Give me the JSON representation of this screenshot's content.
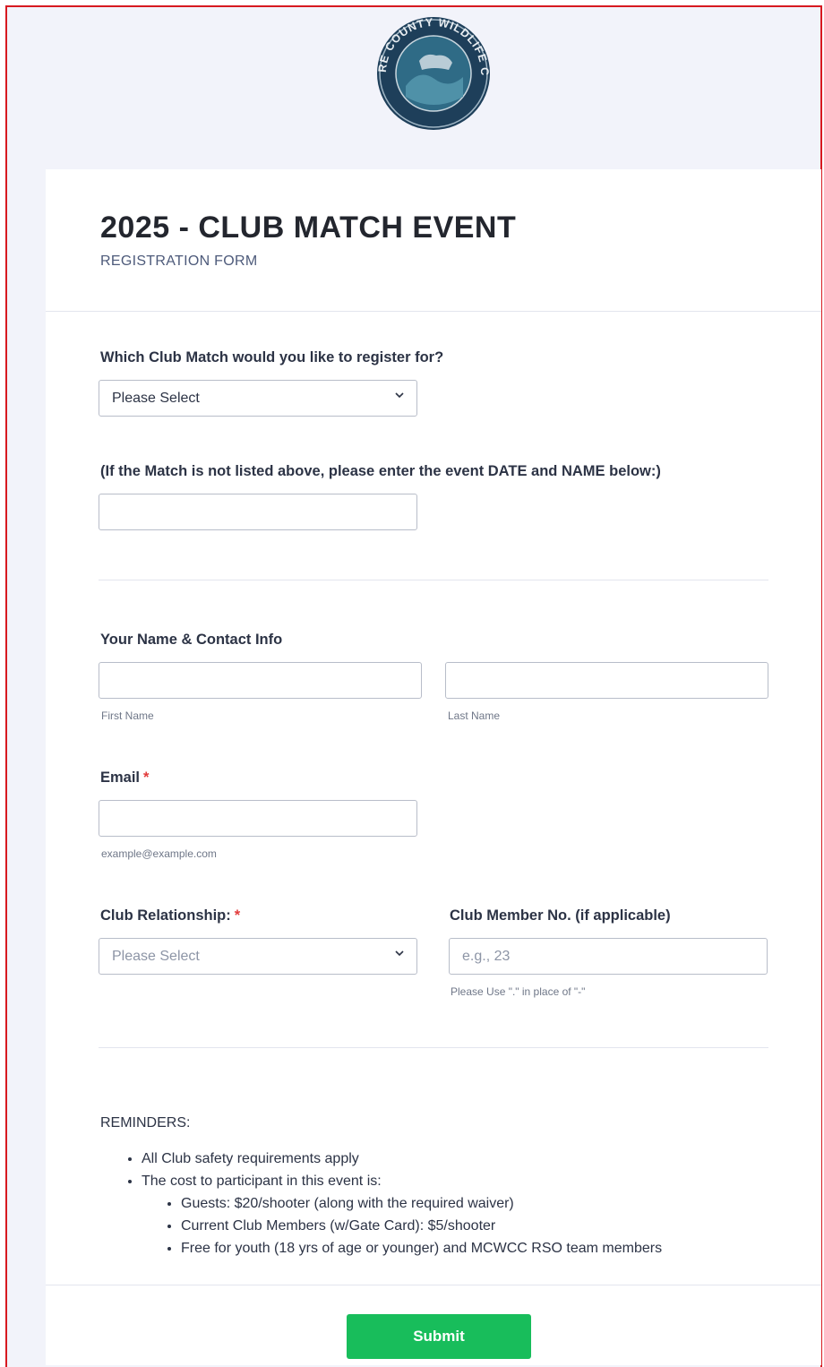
{
  "logo": {
    "text": "MOORE COUNTY WILDLIFE CLUB",
    "ring_color": "#1e3f5a",
    "inner_color": "#2f6b86"
  },
  "form": {
    "title": "2025 - CLUB MATCH EVENT",
    "subtitle": "REGISTRATION FORM",
    "match_question": "Which Club Match would you like to register for?",
    "match_select_value": "Please Select",
    "other_match_label": "(If the Match is not listed above, please enter the event DATE and NAME below:)",
    "other_match_value": "",
    "name_label": "Your Name & Contact Info",
    "first_name_value": "",
    "first_name_sublabel": "First Name",
    "last_name_value": "",
    "last_name_sublabel": "Last Name",
    "email_label": "Email",
    "email_required": "*",
    "email_value": "",
    "email_sublabel": "example@example.com",
    "relationship_label": "Club Relationship:",
    "relationship_required": "*",
    "relationship_select_value": "Please Select",
    "member_no_label": "Club Member No. (if applicable)",
    "member_no_placeholder": "e.g., 23",
    "member_no_sublabel": "Please Use \".\" in place of \"-\"",
    "reminders_heading": "REMINDERS:",
    "reminder_1": "All Club safety requirements apply",
    "reminder_2": "The cost to participant in this event is:",
    "cost_1": "Guests: $20/shooter (along with the required waiver)",
    "cost_2": "Current Club Members (w/Gate Card): $5/shooter",
    "cost_3": "Free for youth (18 yrs of age or younger) and MCWCC RSO team members",
    "submit_label": "Submit"
  },
  "colors": {
    "page_bg": "#f2f3fa",
    "frame_border": "#d71920",
    "submit_bg": "#18bd5b",
    "required_star": "#e23b3b"
  }
}
